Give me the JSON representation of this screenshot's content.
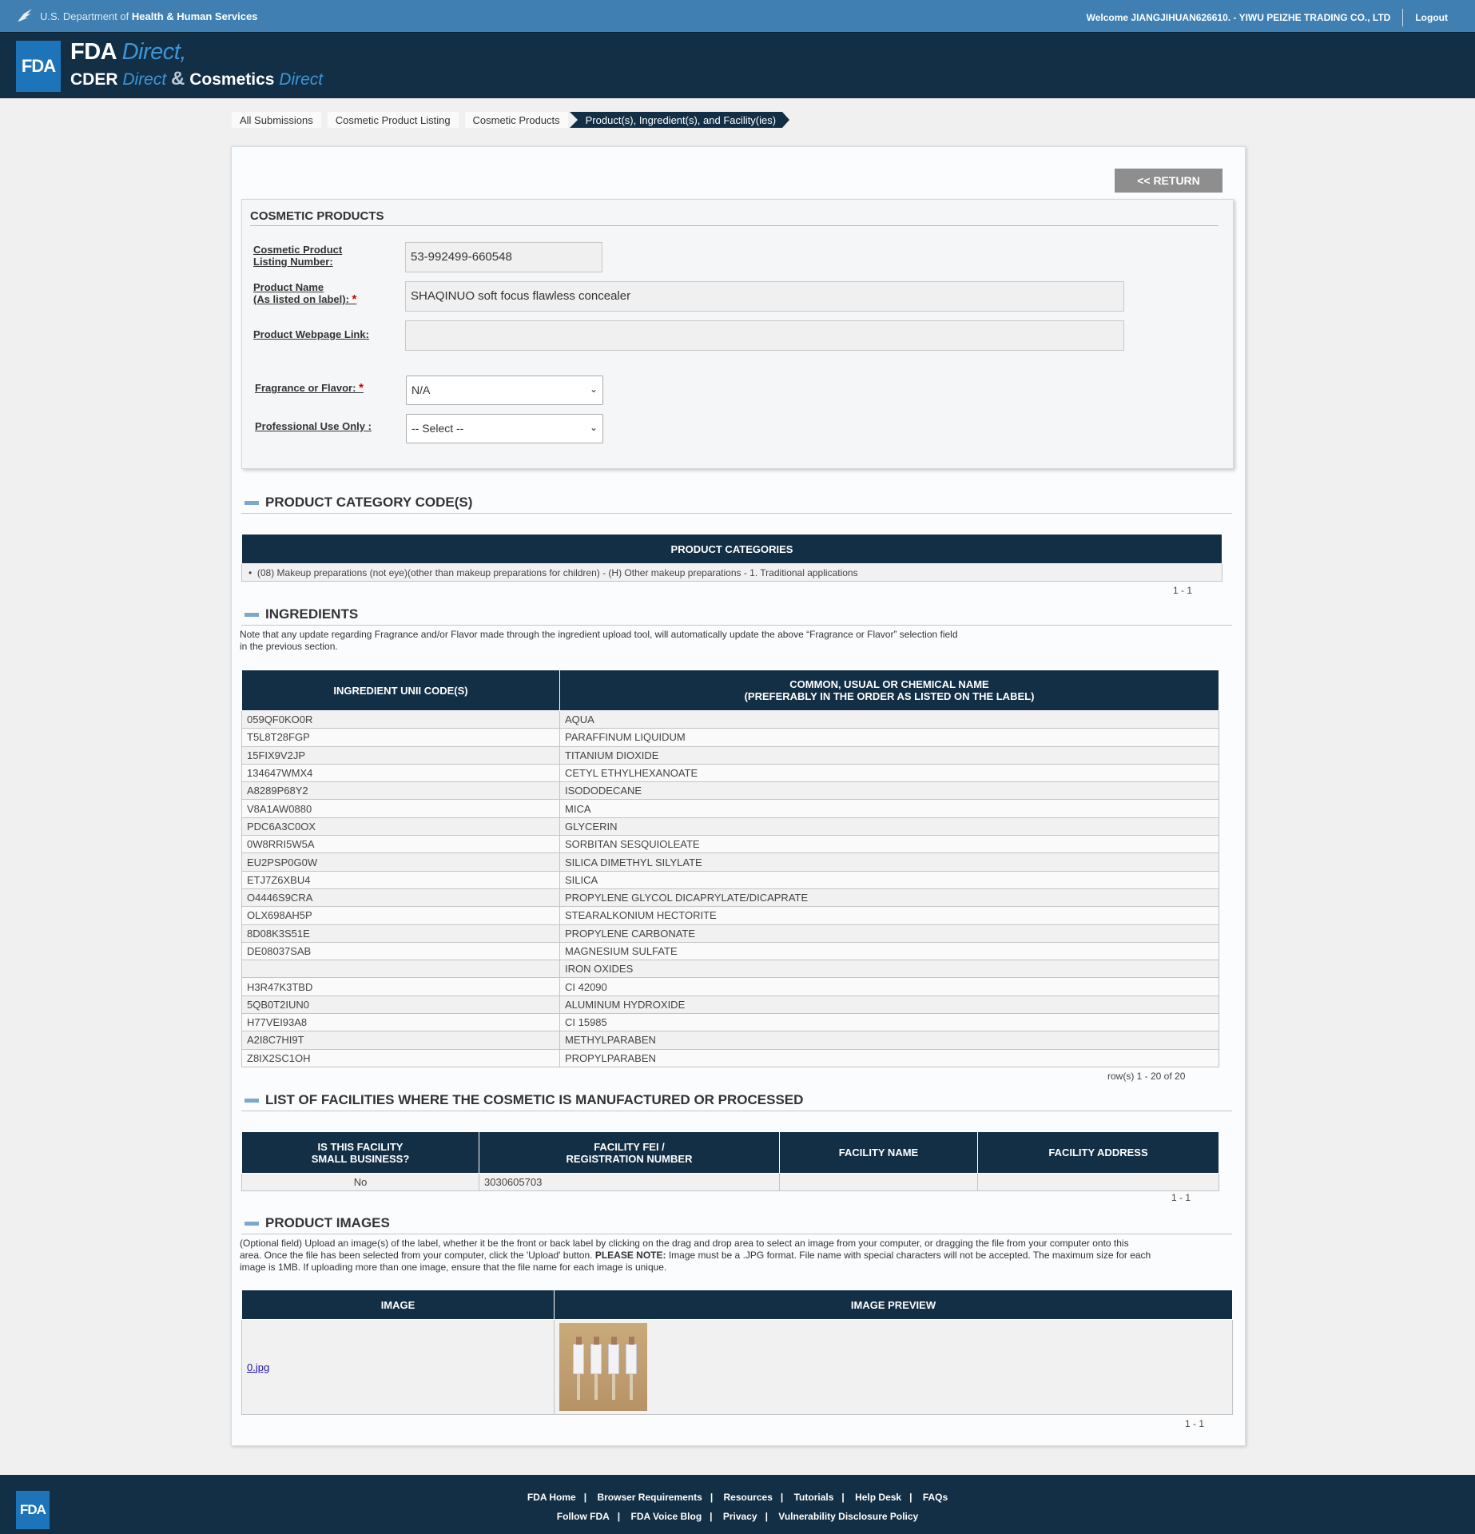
{
  "topbar": {
    "dept_prefix": "U.S. Department of",
    "dept_name": "Health & Human Services",
    "welcome": "Welcome JIANGJIHUAN626610. - YIWU PEIZHE TRADING CO., LTD",
    "logout": "Logout"
  },
  "header": {
    "logo": "FDA",
    "line1_bold": "FDA",
    "line1_italic": "Direct,",
    "line2_cder": "CDER",
    "line2_direct": "Direct",
    "line2_amp": "&",
    "line2_cosmetics": "Cosmetics",
    "line2_direct2": "Direct"
  },
  "breadcrumb": {
    "items": [
      "All Submissions",
      "Cosmetic Product Listing",
      "Cosmetic Products"
    ],
    "active": "Product(s), Ingredient(s), and Facility(ies)"
  },
  "return_label": "<< RETURN",
  "cosmetic_products": {
    "title": "COSMETIC PRODUCTS",
    "listing_label_1": "Cosmetic Product",
    "listing_label_2": "Listing Number:",
    "listing_number": "53-992499-660548",
    "name_label_1": "Product Name",
    "name_label_2": "(As listed on label):",
    "product_name": "SHAQINUO soft focus flawless concealer",
    "webpage_label": "Product Webpage Link:",
    "webpage_value": "",
    "fragrance_label": "Fragrance or Flavor:",
    "fragrance_value": "N/A",
    "professional_label": "Professional Use Only :",
    "professional_value": "-- Select --",
    "required_mark": "*"
  },
  "categories": {
    "title": "PRODUCT CATEGORY CODE(S)",
    "header": "PRODUCT CATEGORIES",
    "items": [
      "(08) Makeup preparations (not eye)(other than makeup preparations for children) - (H) Other makeup preparations - 1. Traditional applications"
    ],
    "pager": "1 - 1"
  },
  "ingredients": {
    "title": "INGREDIENTS",
    "note_1": "Note that any update regarding Fragrance and/or Flavor made through the ingredient upload tool, will automatically update the above “Fragrance or Flavor” selection field",
    "note_2": "in the previous section.",
    "col1": "INGREDIENT UNII CODE(S)",
    "col2_1": "COMMON, USUAL OR CHEMICAL NAME",
    "col2_2": "(PREFERABLY IN THE ORDER AS LISTED ON THE LABEL)",
    "rows": [
      [
        "059QF0KO0R",
        "AQUA"
      ],
      [
        "T5L8T28FGP",
        "PARAFFINUM LIQUIDUM"
      ],
      [
        "15FIX9V2JP",
        "TITANIUM DIOXIDE"
      ],
      [
        "134647WMX4",
        "CETYL ETHYLHEXANOATE"
      ],
      [
        "A8289P68Y2",
        "ISODODECANE"
      ],
      [
        "V8A1AW0880",
        "MICA"
      ],
      [
        "PDC6A3C0OX",
        "GLYCERIN"
      ],
      [
        "0W8RRI5W5A",
        "SORBITAN SESQUIOLEATE"
      ],
      [
        "EU2PSP0G0W",
        "SILICA DIMETHYL SILYLATE"
      ],
      [
        "ETJ7Z6XBU4",
        "SILICA"
      ],
      [
        "O4446S9CRA",
        "PROPYLENE GLYCOL DICAPRYLATE/DICAPRATE"
      ],
      [
        "OLX698AH5P",
        "STEARALKONIUM HECTORITE"
      ],
      [
        "8D08K3S51E",
        "PROPYLENE CARBONATE"
      ],
      [
        "DE08037SAB",
        "MAGNESIUM SULFATE"
      ],
      [
        "",
        "IRON OXIDES"
      ],
      [
        "H3R47K3TBD",
        "CI 42090"
      ],
      [
        "5QB0T2IUN0",
        "ALUMINUM HYDROXIDE"
      ],
      [
        "H77VEI93A8",
        "CI 15985"
      ],
      [
        "A2I8C7HI9T",
        "METHYLPARABEN"
      ],
      [
        "Z8IX2SC1OH",
        "PROPYLPARABEN"
      ]
    ],
    "pager": "row(s) 1 - 20 of 20"
  },
  "facilities": {
    "title": "LIST OF FACILITIES WHERE THE COSMETIC IS MANUFACTURED OR PROCESSED",
    "col1_1": "IS THIS FACILITY",
    "col1_2": "SMALL BUSINESS?",
    "col2_1": "FACILITY FEI /",
    "col2_2": "REGISTRATION NUMBER",
    "col3": "FACILITY NAME",
    "col4": "FACILITY ADDRESS",
    "rows": [
      [
        "No",
        "3030605703",
        "",
        ""
      ]
    ],
    "pager": "1 - 1"
  },
  "images": {
    "title": "PRODUCT IMAGES",
    "note_1": "(Optional field) Upload an image(s) of the label, whether it be the front or back label by clicking on the drag and drop area to select an image from your computer, or dragging the file from your computer onto this",
    "note_2a": "area. Once the file has been selected from your computer, click the 'Upload' button. ",
    "note_2b": "PLEASE NOTE:",
    "note_2c": " Image must be a .JPG format. File name with special characters will not be accepted. The maximum size for each",
    "note_3": "image is 1MB. If uploading more than one image, ensure that the file name for each image is unique.",
    "col1": "IMAGE",
    "col2": "IMAGE PREVIEW",
    "file": "0.jpg",
    "pager": "1 - 1"
  },
  "footer": {
    "logo": "FDA",
    "row1": [
      "FDA Home",
      "Browser Requirements",
      "Resources",
      "Tutorials",
      "Help Desk",
      "FAQs"
    ],
    "row2": [
      "Follow FDA",
      "FDA Voice Blog",
      "Privacy",
      "Vulnerability Disclosure Policy"
    ],
    "separator": "|"
  },
  "colors": {
    "navy": "#132f45",
    "hhs_blue": "#3f7fb2",
    "fda_blue": "#1d74b8",
    "accent_italic": "#3c96d8"
  }
}
